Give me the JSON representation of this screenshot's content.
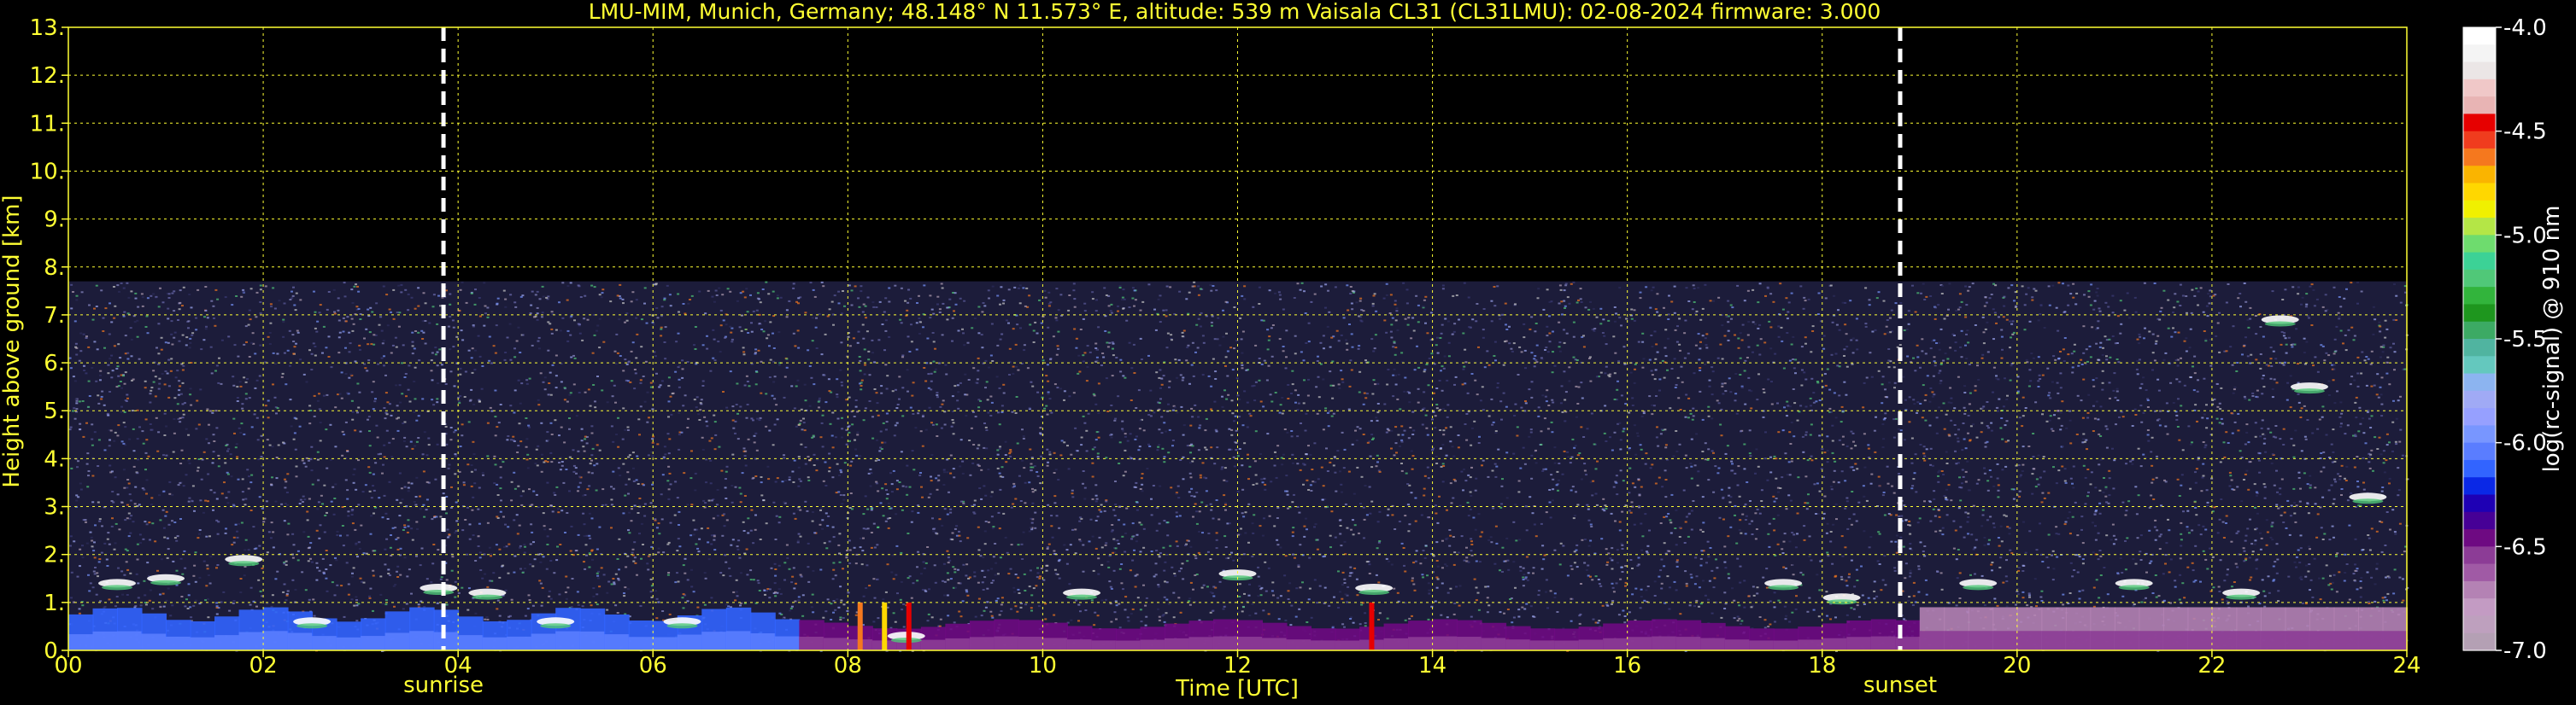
{
  "chart_data": {
    "type": "heatmap",
    "title": "LMU-MIM, Munich, Germany; 48.148° N 11.573° E, altitude: 539 m    Vaisala CL31 (CL31LMU): 02-08-2024    firmware: 3.000",
    "xlabel": "Time [UTC]",
    "ylabel": "Height above ground [km]",
    "xlim": [
      0,
      24
    ],
    "ylim": [
      0,
      13
    ],
    "x_ticks": [
      "00",
      "02",
      "04",
      "06",
      "08",
      "10",
      "12",
      "14",
      "16",
      "18",
      "20",
      "22",
      "24"
    ],
    "y_ticks": [
      "0.",
      "1.",
      "2.",
      "3.",
      "4.",
      "5.",
      "6.",
      "7.",
      "8.",
      "9.",
      "10.",
      "11.",
      "12.",
      "13."
    ],
    "grid": true,
    "annotations": [
      {
        "label": "sunrise",
        "x": 3.85
      },
      {
        "label": "sunset",
        "x": 18.8
      }
    ],
    "colorbar": {
      "label": "log(rc-signal) @ 910 nm",
      "range": [
        -7.0,
        -4.0
      ],
      "ticks": [
        "-4.0",
        "-4.5",
        "-5.0",
        "-5.5",
        "-6.0",
        "-6.5",
        "-7.0"
      ],
      "colors_top_to_bottom": [
        "#ffffff",
        "#f4f4f4",
        "#ebe6e6",
        "#f0c8c8",
        "#e8b4b4",
        "#e60000",
        "#f03c1e",
        "#f5781e",
        "#fab400",
        "#ffd700",
        "#f0f000",
        "#b4e646",
        "#6edc6e",
        "#3cd296",
        "#50c878",
        "#32b43c",
        "#1e961e",
        "#3caa64",
        "#50b4a0",
        "#64c8be",
        "#8cb4f0",
        "#a0aaf5",
        "#96a0ff",
        "#7896ff",
        "#5a7dff",
        "#3264ff",
        "#0a28e6",
        "#1e00b4",
        "#460096",
        "#6e0a82",
        "#8c3c96",
        "#a05aa5",
        "#b482b4",
        "#c39bc3",
        "#bea0be",
        "#b4a0b4"
      ]
    },
    "ceiling_km": 7.7,
    "series": [
      {
        "name": "",
        "description_values": [
          {
            "x": 0.5,
            "y": 1.4
          },
          {
            "x": 1.0,
            "y": 1.5
          },
          {
            "x": 1.8,
            "y": 1.9
          },
          {
            "x": 2.5,
            "y": 0.6
          },
          {
            "x": 3.8,
            "y": 1.3
          },
          {
            "x": 4.3,
            "y": 1.2
          },
          {
            "x": 5.0,
            "y": 0.6
          },
          {
            "x": 6.3,
            "y": 0.6
          },
          {
            "x": 8.6,
            "y": 0.3
          },
          {
            "x": 10.4,
            "y": 1.2
          },
          {
            "x": 12.0,
            "y": 1.6
          },
          {
            "x": 13.4,
            "y": 1.3
          },
          {
            "x": 17.6,
            "y": 1.4
          },
          {
            "x": 18.2,
            "y": 1.1
          },
          {
            "x": 19.6,
            "y": 1.4
          },
          {
            "x": 21.2,
            "y": 1.4
          },
          {
            "x": 22.3,
            "y": 1.2
          },
          {
            "x": 22.7,
            "y": 6.9
          },
          {
            "x": 23.0,
            "y": 5.5
          },
          {
            "x": 23.6,
            "y": 3.2
          }
        ]
      }
    ]
  }
}
